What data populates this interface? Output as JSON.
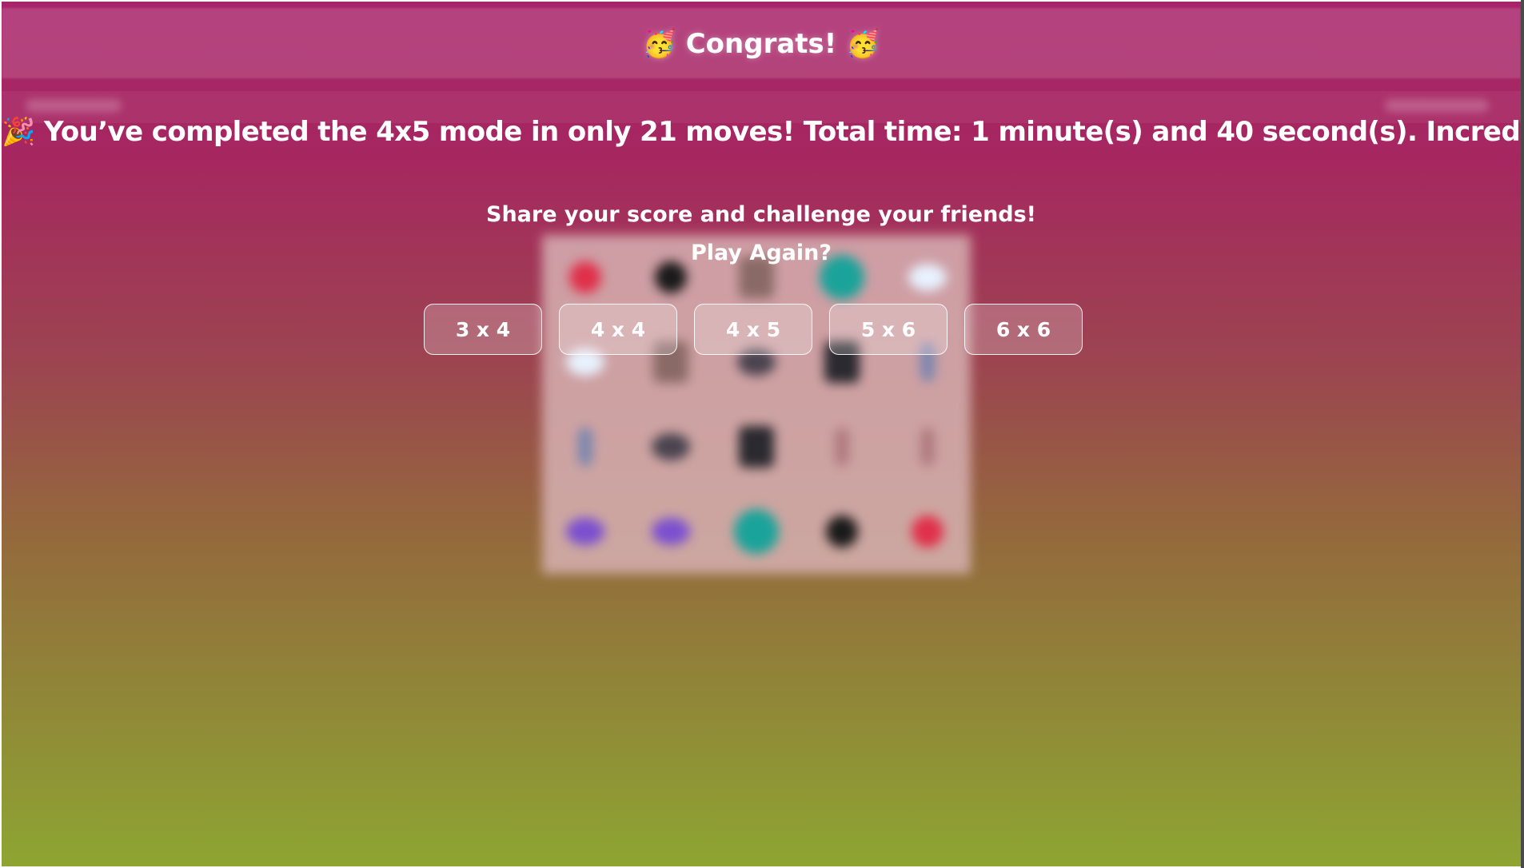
{
  "overlay": {
    "title": "🥳 Congrats! 🥳",
    "message": "🎉 You’ve completed the 4x5 mode in only 21 moves! Total time: 1 minute(s) and 40 second(s). Incredible!",
    "share_text": "Share your score and challenge your friends!",
    "play_again_label": "Play Again?",
    "mode_buttons": [
      {
        "label": "3 x 4"
      },
      {
        "label": "4 x 4"
      },
      {
        "label": "4 x 5"
      },
      {
        "label": "5 x 6"
      },
      {
        "label": "6 x 6"
      }
    ]
  },
  "board": {
    "mode": "4x5",
    "rows": 4,
    "cols": 5,
    "tiles": [
      {
        "icon": "red-heart-icon",
        "color": "#e0304a"
      },
      {
        "icon": "black-heart-icon",
        "color": "#1a1a1a"
      },
      {
        "icon": "brown-card-icon",
        "color": "#8a6a66"
      },
      {
        "icon": "globe-icon",
        "color": "#1aa39a"
      },
      {
        "icon": "cloud-icon",
        "color": "#e8f2ff"
      },
      {
        "icon": "cloud-icon",
        "color": "#e8f2ff"
      },
      {
        "icon": "brown-card-icon",
        "color": "#8a6a66"
      },
      {
        "icon": "dark-gadget-icon",
        "color": "#4a4450"
      },
      {
        "icon": "dark-vessel-icon",
        "color": "#2a2a30"
      },
      {
        "icon": "pen-icon",
        "color": "#7a86b0"
      },
      {
        "icon": "pen-icon",
        "color": "#7a86b0"
      },
      {
        "icon": "dark-gadget-icon",
        "color": "#4a4450"
      },
      {
        "icon": "dark-vessel-icon",
        "color": "#2a2a30"
      },
      {
        "icon": "thin-bottle-icon",
        "color": "#b07a80"
      },
      {
        "icon": "thin-bottle-icon",
        "color": "#b07a80"
      },
      {
        "icon": "purple-gem-icon",
        "color": "#7b4fd0"
      },
      {
        "icon": "purple-gem-icon",
        "color": "#7b4fd0"
      },
      {
        "icon": "globe-icon",
        "color": "#1aa39a"
      },
      {
        "icon": "black-heart-icon",
        "color": "#1a1a1a"
      },
      {
        "icon": "red-heart-icon",
        "color": "#e0304a"
      }
    ]
  },
  "colors": {
    "gradient_top": "#a8246a",
    "gradient_bottom": "#8ea532",
    "text": "#ffffff"
  }
}
